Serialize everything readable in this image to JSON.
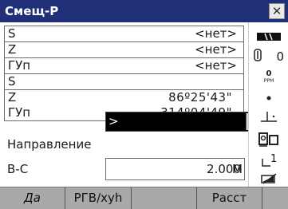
{
  "window": {
    "title": "Смещ-Р",
    "close_icon": "close-icon"
  },
  "panel1": {
    "rows": [
      {
        "label": "S",
        "value": "<нет>"
      },
      {
        "label": "Z",
        "value": "<нет>"
      },
      {
        "label": "ГУп",
        "value": "<нет>"
      }
    ]
  },
  "panel2": {
    "rows": [
      {
        "label": "S",
        "value": ""
      },
      {
        "label": "Z",
        "value": "86º25'43\""
      },
      {
        "label": "ГУп",
        "value": "314º04'49\""
      }
    ]
  },
  "direction": {
    "label": "Направление",
    "selected": ">"
  },
  "bc": {
    "label": "В-С",
    "value": "2.000",
    "unit": "М"
  },
  "sidebar": {
    "signal_icon": "signal-strength-icon",
    "prism_icon": "prism-icon",
    "prism_constant": "0",
    "ppm_label": "PPM",
    "ppm_value": "0",
    "dot_icon": "tilt-indicator-icon",
    "level_icon": "level-icon",
    "mode_icon": "measure-mode-icon",
    "face_icon": "face-indicator-icon",
    "face_value": "1",
    "battery_icon": "battery-icon"
  },
  "softkeys": [
    "Да",
    "РГВ/xyh",
    "",
    "Расст",
    ""
  ],
  "colors": {
    "titlebar": "#1f2f78",
    "softkey_bar": "#a9a9a9",
    "select_bg": "#000000"
  }
}
